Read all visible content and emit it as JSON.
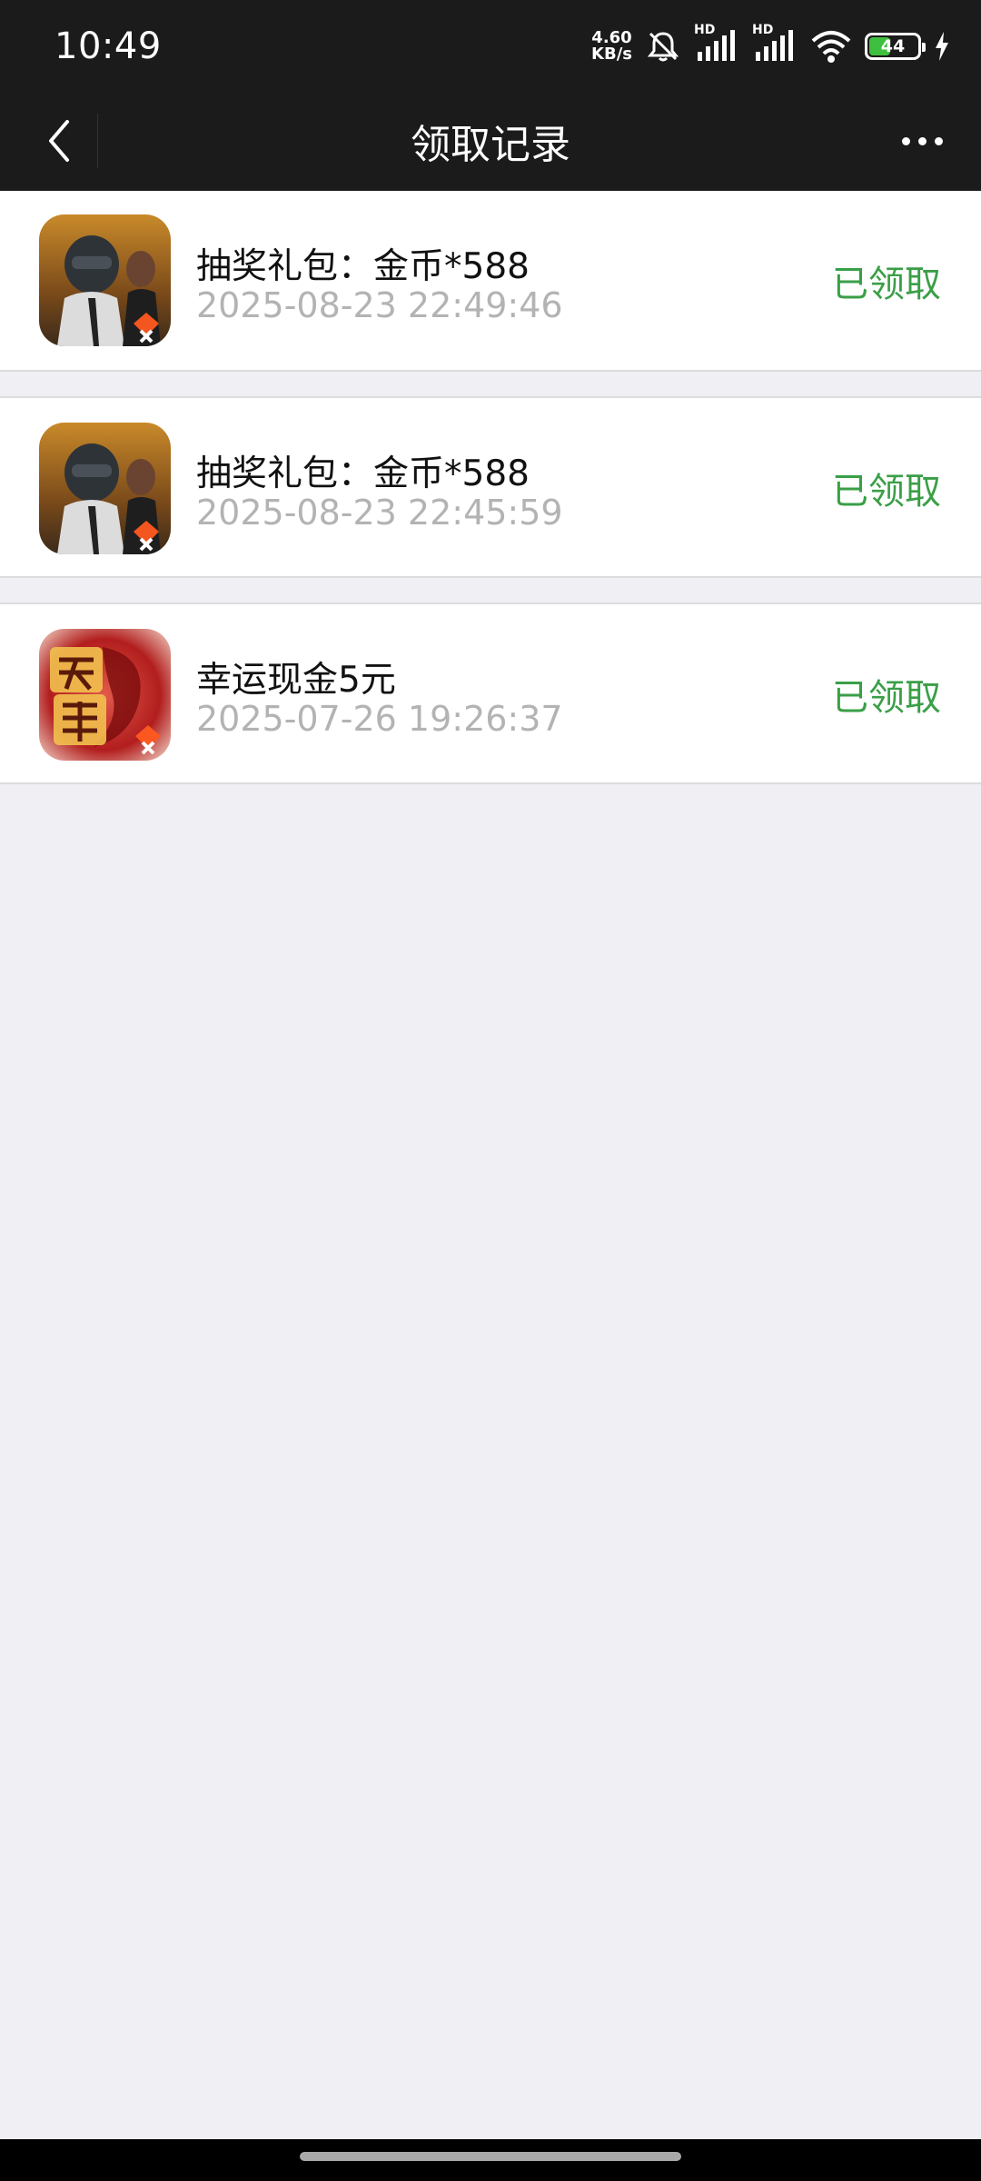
{
  "status_bar": {
    "time": "10:49",
    "net_speed_value": "4.60",
    "net_speed_unit": "KB/s",
    "signal1_label": "HD",
    "signal2_label": "HD",
    "battery_level": "44",
    "battery_percent": 44,
    "icons": [
      "mute-icon",
      "signal-icon",
      "signal-icon",
      "wifi-icon",
      "battery-icon",
      "charging-icon"
    ]
  },
  "nav": {
    "title": "领取记录",
    "back_icon": "chevron-left-icon",
    "more_icon": "more-dots-icon"
  },
  "records": [
    {
      "title": "抽奖礼包：金币*588",
      "time": "2025-08-23 22:49:46",
      "status": "已领取",
      "icon": "game-icon-pubg"
    },
    {
      "title": "抽奖礼包：金币*588",
      "time": "2025-08-23 22:45:59",
      "status": "已领取",
      "icon": "game-icon-pubg"
    },
    {
      "title": "幸运现金5元",
      "time": "2025-07-26 19:26:37",
      "status": "已领取",
      "icon": "game-icon-tianlong"
    }
  ],
  "colors": {
    "header_bg": "#1b1b1b",
    "page_bg": "#efeff4",
    "status_green": "#3a9f47",
    "time_gray": "#b3b3b3"
  }
}
